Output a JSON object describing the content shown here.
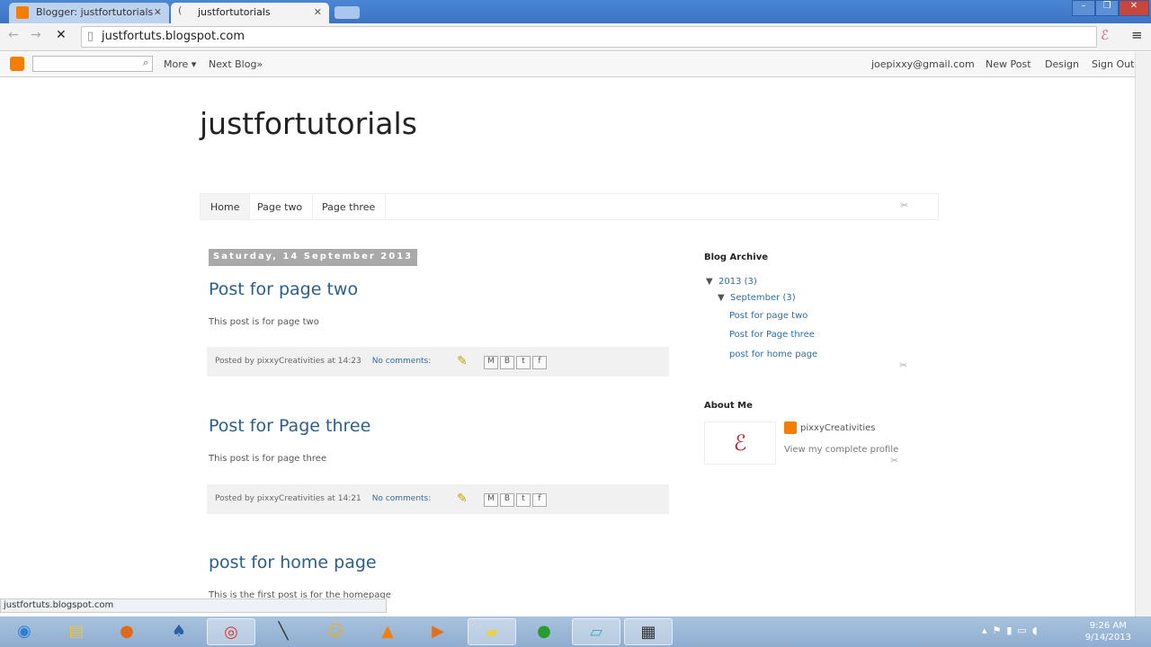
{
  "browser": {
    "tabs": [
      {
        "label": "Blogger: justfortutorials -"
      },
      {
        "label": "justfortutorials"
      }
    ],
    "url": "justfortuts.blogspot.com",
    "status": "justfortuts.blogspot.com"
  },
  "navbar": {
    "more": "More ▾",
    "next_blog": "Next Blog»",
    "email": "joepixxy@gmail.com",
    "new_post": "New Post",
    "design": "Design",
    "sign_out": "Sign Out"
  },
  "blog": {
    "title": "justfortutorials",
    "tabs": [
      "Home",
      "Page two",
      "Page three"
    ]
  },
  "posts": [
    {
      "date": "Saturday, 14 September 2013",
      "title": "Post for page two",
      "body": "This post is for page two",
      "posted_by": "Posted by pixxyCreativities at 14:23",
      "comments": "No comments:"
    },
    {
      "title": "Post for Page three",
      "body": "This post is for page three",
      "posted_by": "Posted by pixxyCreativities at 14:21",
      "comments": "No comments:"
    },
    {
      "title": "post for home page",
      "body": "This is the first post is for the homepage"
    }
  ],
  "sidebar": {
    "archive_title": "Blog Archive",
    "year": "2013 (3)",
    "month": "September (3)",
    "links": [
      "Post for page two",
      "Post for Page three",
      "post for home page"
    ],
    "about_title": "About Me",
    "profile_name": "pixxyCreativities",
    "profile_link": "View my complete profile"
  },
  "taskbar": {
    "time": "9:26 AM",
    "date": "9/14/2013"
  }
}
